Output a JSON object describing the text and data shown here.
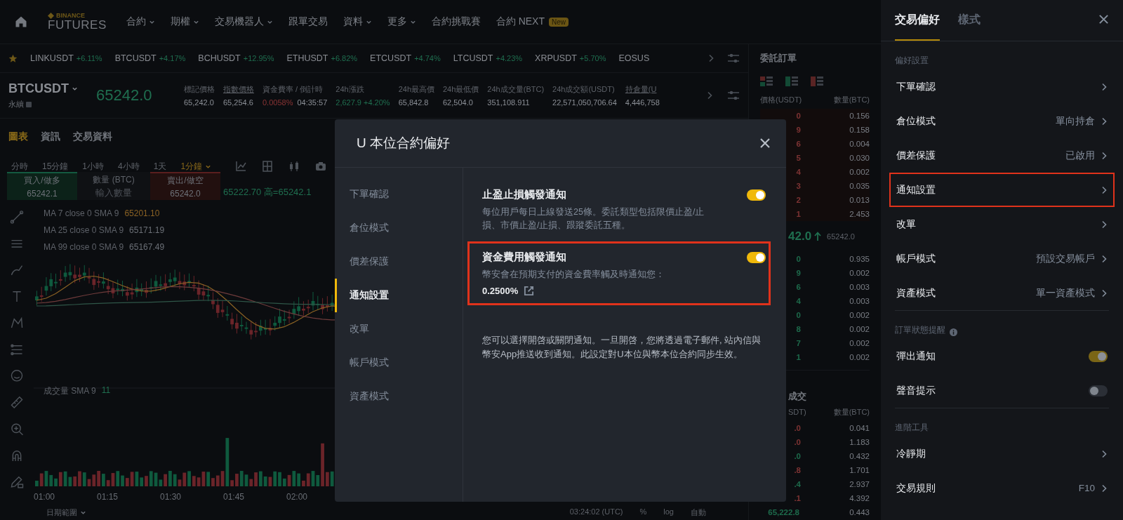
{
  "top_nav": {
    "logo_top": "BINANCE",
    "logo_bottom": "FUTURES",
    "items": [
      {
        "label": "合約",
        "has_menu": true
      },
      {
        "label": "期權",
        "has_menu": true
      },
      {
        "label": "交易機器人",
        "has_menu": true
      },
      {
        "label": "跟單交易",
        "has_menu": false
      },
      {
        "label": "資料",
        "has_menu": true
      },
      {
        "label": "更多",
        "has_menu": true
      },
      {
        "label": "合約挑戰賽",
        "has_menu": false
      },
      {
        "label": "合約 NEXT",
        "has_menu": false,
        "badge": "New"
      }
    ]
  },
  "ticker": {
    "items": [
      {
        "symbol": "LINKUSDT",
        "change": "+6.11%"
      },
      {
        "symbol": "BTCUSDT",
        "change": "+4.17%"
      },
      {
        "symbol": "BCHUSDT",
        "change": "+12.95%"
      },
      {
        "symbol": "ETHUSDT",
        "change": "+6.82%"
      },
      {
        "symbol": "ETCUSDT",
        "change": "+4.74%"
      },
      {
        "symbol": "LTCUSDT",
        "change": "+4.23%"
      },
      {
        "symbol": "XRPUSDT",
        "change": "+5.70%"
      },
      {
        "symbol": "EOSUS"
      }
    ]
  },
  "symbol_header": {
    "symbol": "BTCUSDT",
    "contract_type": "永續",
    "price": "65242.0",
    "stats": [
      {
        "label": "標記價格",
        "underlined": false,
        "values": [
          {
            "text": "65,242.0",
            "color": "#8b8f96"
          }
        ]
      },
      {
        "label": "指數價格",
        "underlined": true,
        "values": [
          {
            "text": "65,254.6",
            "color": "#8b8f96"
          }
        ]
      },
      {
        "label": "資金費率 / 倒計時",
        "underlined": false,
        "values": [
          {
            "text": "0.0058%",
            "color": "#8a3434"
          },
          {
            "text": "04:35:57",
            "color": "#8b8f96"
          }
        ]
      },
      {
        "label": "24h漲跌",
        "underlined": false,
        "values": [
          {
            "text": "2,627.9 +4.20%",
            "color": "#1f6e4f"
          }
        ]
      },
      {
        "label": "24h最高價",
        "underlined": false,
        "values": [
          {
            "text": "65,842.8",
            "color": "#8b8f96"
          }
        ]
      },
      {
        "label": "24h最低價",
        "underlined": false,
        "values": [
          {
            "text": "62,504.0",
            "color": "#8b8f96"
          }
        ]
      },
      {
        "label": "24h成交量(BTC)",
        "underlined": false,
        "values": [
          {
            "text": "351,108.911",
            "color": "#8b8f96"
          }
        ]
      },
      {
        "label": "24h成交額(USDT)",
        "underlined": false,
        "values": [
          {
            "text": "22,571,050,706.64",
            "color": "#8b8f96"
          }
        ]
      },
      {
        "label": "持倉量(U",
        "underlined": true,
        "values": [
          {
            "text": "4,446,758",
            "color": "#8b8f96"
          }
        ]
      }
    ]
  },
  "chart_panel": {
    "tabs": [
      {
        "label": "圖表",
        "selected": true
      },
      {
        "label": "資訊",
        "selected": false
      },
      {
        "label": "交易資料",
        "selected": false
      }
    ],
    "intervals": [
      {
        "label": "分時",
        "selected": false,
        "has_menu": false
      },
      {
        "label": "15分鐘",
        "selected": false,
        "has_menu": false
      },
      {
        "label": "1小時",
        "selected": false,
        "has_menu": false
      },
      {
        "label": "4小時",
        "selected": false,
        "has_menu": false
      },
      {
        "label": "1天",
        "selected": false,
        "has_menu": false
      },
      {
        "label": "1分鐘",
        "selected": true,
        "has_menu": true
      }
    ],
    "order_widget": {
      "buy_label": "買入/做多",
      "buy_price": "65242.1",
      "quantity_label": "數量 (BTC)",
      "quantity_placeholder": "輸入數量",
      "sell_label": "賣出/做空",
      "sell_price": "65242.0"
    },
    "ohlc": "65222.70 高=65242.1",
    "moving_averages": [
      {
        "label": "MA 7 close 0 SMA 9",
        "value": "65201.10",
        "color": "#8a6224"
      },
      {
        "label": "MA 25 close 0 SMA 9",
        "value": "65171.19",
        "color": "#6e3b3b"
      },
      {
        "label": "MA 99 close 0 SMA 9",
        "value": "65167.49",
        "color": "#2f5648"
      }
    ],
    "volume": {
      "label": "成交量 SMA 9",
      "value": "11"
    },
    "time_axis": [
      "01:00",
      "01:15",
      "01:30",
      "01:45",
      "02:00"
    ],
    "bottom_bar": {
      "date_range": "日期範圍",
      "time": "03:24:02 (UTC)",
      "options": [
        "%",
        "log",
        "自動"
      ]
    }
  },
  "order_book": {
    "title": "委託訂單",
    "price_header": "價格(USDT)",
    "qty_header": "數量(BTC)",
    "asks": [
      {
        "price": "0",
        "qty": "0.156"
      },
      {
        "price": "9",
        "qty": "0.158"
      },
      {
        "price": "6",
        "qty": "0.004"
      },
      {
        "price": "5",
        "qty": "0.030"
      },
      {
        "price": "4",
        "qty": "0.002"
      },
      {
        "price": "3",
        "qty": "0.035"
      },
      {
        "price": "2",
        "qty": "0.013"
      },
      {
        "price": "1",
        "qty": "2.453"
      }
    ],
    "last_price": "42.0",
    "mark_price": "65242.0",
    "bids": [
      {
        "price": "0",
        "qty": "0.935"
      },
      {
        "price": "9",
        "qty": "0.002"
      },
      {
        "price": "6",
        "qty": "0.003"
      },
      {
        "price": "4",
        "qty": "0.003"
      },
      {
        "price": "0",
        "qty": "0.002"
      },
      {
        "price": "8",
        "qty": "0.002"
      },
      {
        "price": "7",
        "qty": "0.002"
      },
      {
        "price": "1",
        "qty": "0.002"
      }
    ]
  },
  "trades": {
    "title": "成交",
    "price_header": "SDT)",
    "qty_header": "數量(BTC)",
    "rows": [
      {
        "price": ".0",
        "qty": "0.041",
        "color": "#7d3333"
      },
      {
        "price": ".0",
        "qty": "1.183",
        "color": "#7d3333"
      },
      {
        "price": ".0",
        "qty": "0.432",
        "color": "#1d6a4b"
      },
      {
        "price": ".8",
        "qty": "1.701",
        "color": "#7d3333"
      },
      {
        "price": ".4",
        "qty": "2.937",
        "color": "#1d6a4b"
      },
      {
        "price": ".1",
        "qty": "4.392",
        "color": "#7d3333"
      },
      {
        "price": "65,222.8",
        "qty": "0.443",
        "color": "#1d6a4b"
      }
    ]
  },
  "drawer": {
    "tabs": [
      {
        "label": "交易偏好",
        "selected": true
      },
      {
        "label": "樣式",
        "selected": false
      }
    ],
    "sections": [
      {
        "title": "偏好設置",
        "info": false,
        "items": [
          {
            "kind": "link",
            "label": "下單確認",
            "highlighted": false
          },
          {
            "kind": "link",
            "label": "倉位模式",
            "value": "單向持倉",
            "highlighted": false
          },
          {
            "kind": "link",
            "label": "價差保護",
            "value": "已啟用",
            "highlighted": false
          },
          {
            "kind": "link",
            "label": "通知設置",
            "highlighted": true
          },
          {
            "kind": "link",
            "label": "改單",
            "highlighted": false
          },
          {
            "kind": "link",
            "label": "帳戶模式",
            "value": "預設交易帳戶",
            "highlighted": false
          },
          {
            "kind": "link",
            "label": "資產模式",
            "value": "單一資產模式",
            "highlighted": false
          }
        ]
      },
      {
        "title": "訂單狀態提醒",
        "info": true,
        "items": [
          {
            "kind": "toggle",
            "label": "彈出通知",
            "on": true,
            "highlighted": false
          },
          {
            "kind": "toggle",
            "label": "聲音提示",
            "on": false,
            "highlighted": false
          }
        ]
      },
      {
        "title": "進階工具",
        "info": false,
        "items": [
          {
            "kind": "link",
            "label": "冷靜期",
            "highlighted": false
          },
          {
            "kind": "link",
            "label": "交易規則",
            "value": "F10",
            "highlighted": false
          }
        ]
      }
    ]
  },
  "modal": {
    "title": "U 本位合約偏好",
    "nav": [
      {
        "label": "下單確認",
        "selected": false
      },
      {
        "label": "倉位模式",
        "selected": false
      },
      {
        "label": "價差保護",
        "selected": false
      },
      {
        "label": "通知設置",
        "selected": true
      },
      {
        "label": "改單",
        "selected": false
      },
      {
        "label": "帳戶模式",
        "selected": false
      },
      {
        "label": "資產模式",
        "selected": false
      }
    ],
    "notifications": [
      {
        "title": "止盈止損觸發通知",
        "description": "每位用戶每日上線發送25條。委託類型包括限價止盈/止損、市價止盈/止損、跟蹤委託五種。",
        "on": true,
        "highlighted": false
      },
      {
        "title": "資金費用觸發通知",
        "description": "幣安會在預期支付的資金費率觸及時通知您：",
        "value": "0.2500%",
        "on": true,
        "highlighted": true
      }
    ],
    "note": "您可以選擇開啓或關閉通知。一旦開啓，您將透過電子郵件, 站內信與幣安App推送收到通知。此設定對U本位與幣本位合約同步生效。"
  }
}
